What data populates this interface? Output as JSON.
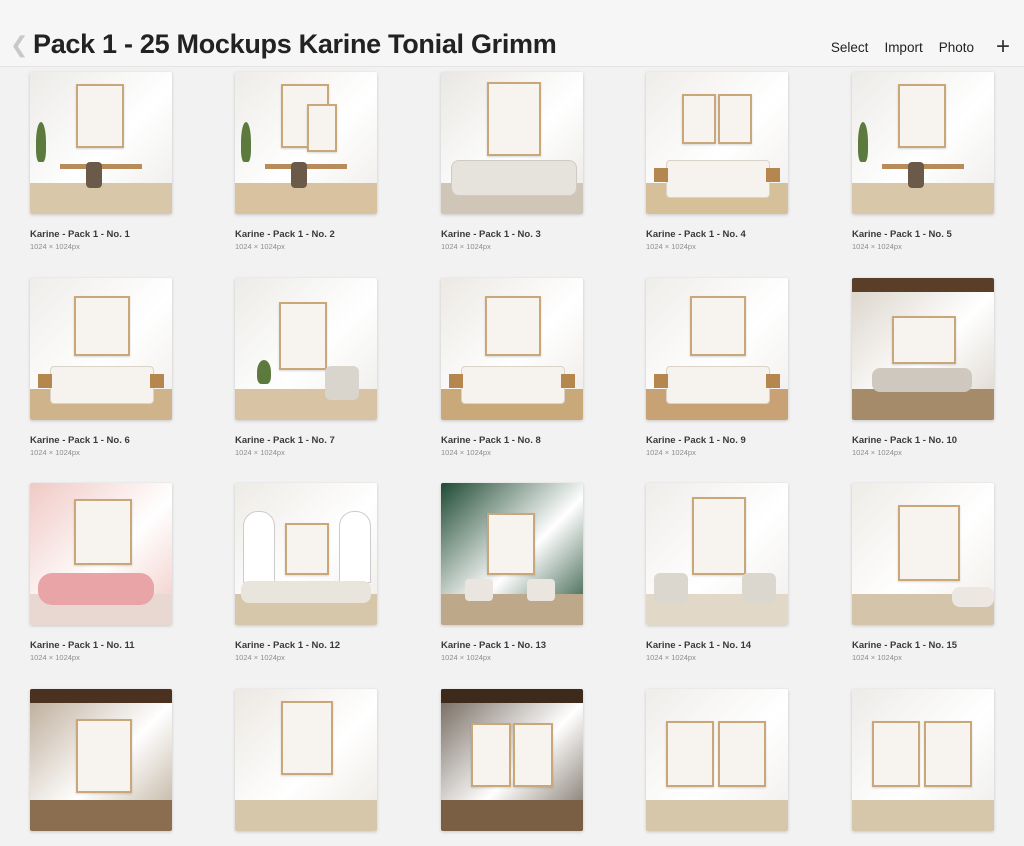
{
  "header": {
    "title": "Pack 1 - 25 Mockups Karine Tonial Grimm",
    "actions": [
      "Select",
      "Import",
      "Photo"
    ]
  },
  "items": [
    {
      "name": "Karine - Pack 1 - No. 1",
      "size": "1024 × 1024px",
      "scene": "desk",
      "wall": "#ecebe8",
      "floor": "#d9c7aa"
    },
    {
      "name": "Karine - Pack 1 - No. 2",
      "size": "1024 × 1024px",
      "scene": "desk2",
      "wall": "#eeece8",
      "floor": "#d8c2a0"
    },
    {
      "name": "Karine - Pack 1 - No. 3",
      "size": "1024 × 1024px",
      "scene": "sofa",
      "wall": "#e9e7e3",
      "floor": "#cfc6b8"
    },
    {
      "name": "Karine - Pack 1 - No. 4",
      "size": "1024 × 1024px",
      "scene": "bed2",
      "wall": "#efedea",
      "floor": "#d6c09a"
    },
    {
      "name": "Karine - Pack 1 - No. 5",
      "size": "1024 × 1024px",
      "scene": "desk",
      "wall": "#ecebe8",
      "floor": "#d9c7aa"
    },
    {
      "name": "Karine - Pack 1 - No. 6",
      "size": "1024 × 1024px",
      "scene": "bed",
      "wall": "#efedea",
      "floor": "#cfb38b"
    },
    {
      "name": "Karine - Pack 1 - No. 7",
      "size": "1024 × 1024px",
      "scene": "chair",
      "wall": "#ecebe7",
      "floor": "#d8c4a5"
    },
    {
      "name": "Karine - Pack 1 - No. 8",
      "size": "1024 × 1024px",
      "scene": "bed",
      "wall": "#ece9e4",
      "floor": "#c9a87a"
    },
    {
      "name": "Karine - Pack 1 - No. 9",
      "size": "1024 × 1024px",
      "scene": "bed",
      "wall": "#efedea",
      "floor": "#c8a274"
    },
    {
      "name": "Karine - Pack 1 - No. 10",
      "size": "1024 × 1024px",
      "scene": "loft",
      "wall": "#d9d2c8",
      "floor": "#a68b6a"
    },
    {
      "name": "Karine - Pack 1 - No. 11",
      "size": "1024 × 1024px",
      "scene": "pink",
      "wall": "#f0c9c4",
      "floor": "#e9d8d2"
    },
    {
      "name": "Karine - Pack 1 - No. 12",
      "size": "1024 × 1024px",
      "scene": "arch",
      "wall": "#eeebe6",
      "floor": "#d6c6aa"
    },
    {
      "name": "Karine - Pack 1 - No. 13",
      "size": "1024 × 1024px",
      "scene": "green",
      "wall": "#1f4a33",
      "floor": "#bda98a"
    },
    {
      "name": "Karine - Pack 1 - No. 14",
      "size": "1024 × 1024px",
      "scene": "chairs",
      "wall": "#efedea",
      "floor": "#e2d8c8"
    },
    {
      "name": "Karine - Pack 1 - No. 15",
      "size": "1024 × 1024px",
      "scene": "archsofa",
      "wall": "#efece7",
      "floor": "#d3c4aa"
    },
    {
      "name": "",
      "size": "",
      "scene": "dark",
      "wall": "#b9a994",
      "floor": "#8b6e4f"
    },
    {
      "name": "",
      "size": "",
      "scene": "plain",
      "wall": "#ece8e2",
      "floor": "#d6c6aa"
    },
    {
      "name": "",
      "size": "",
      "scene": "darkbeam",
      "wall": "#6e6357",
      "floor": "#7a5f44"
    },
    {
      "name": "",
      "size": "",
      "scene": "double",
      "wall": "#efedea",
      "floor": "#d6c6aa"
    },
    {
      "name": "",
      "size": "",
      "scene": "double",
      "wall": "#ecebe8",
      "floor": "#d6c6aa"
    }
  ]
}
